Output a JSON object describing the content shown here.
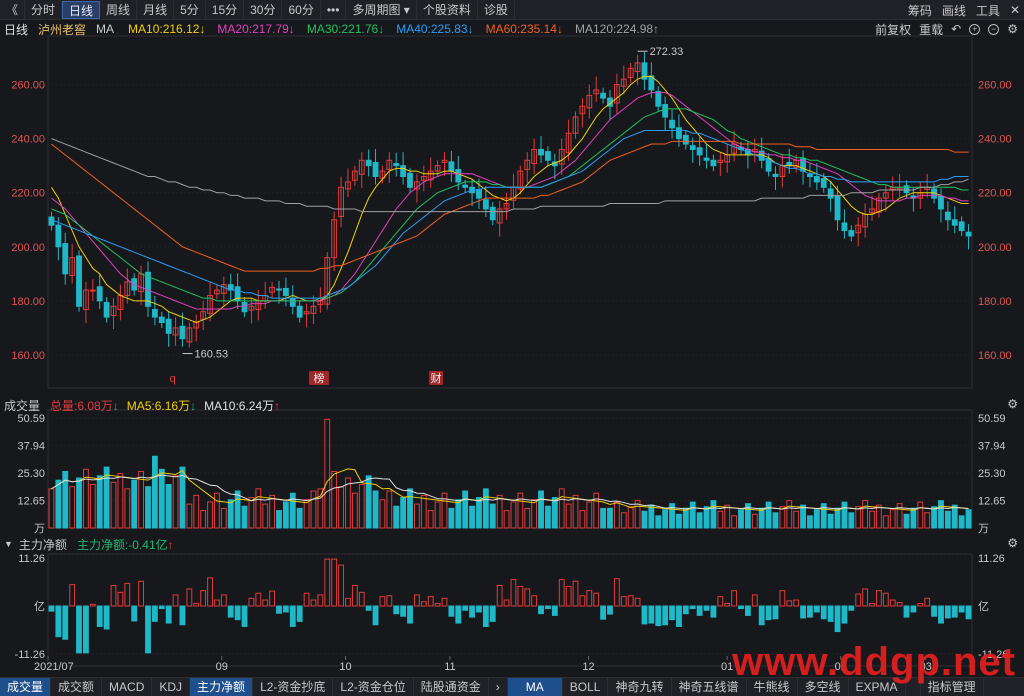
{
  "toolbar": {
    "back": "《",
    "items": [
      "分时",
      "日线",
      "周线",
      "月线",
      "5分",
      "15分",
      "30分",
      "60分",
      "•••",
      "多周期图",
      "个股资料",
      "诊股"
    ],
    "active": 1,
    "right": [
      "筹码",
      "画线",
      "工具",
      "✕"
    ]
  },
  "price_info": {
    "period": "日线",
    "name": "泸州老窖",
    "ma_label": "MA",
    "ma": [
      {
        "text": "MA10:216.12",
        "arrow": "↓",
        "color": "#f0d000"
      },
      {
        "text": "MA20:217.79",
        "arrow": "↓",
        "color": "#e040c0"
      },
      {
        "text": "MA30:221.76",
        "arrow": "↓",
        "color": "#20c060"
      },
      {
        "text": "MA40:225.83",
        "arrow": "↓",
        "color": "#2a9df4"
      },
      {
        "text": "MA60:235.14",
        "arrow": "↓",
        "color": "#f06020"
      },
      {
        "text": "MA120:224.98",
        "arrow": "↑",
        "color": "#a0a0a0"
      }
    ],
    "right": [
      "前复权",
      "重载"
    ]
  },
  "vol_info": {
    "title": "成交量",
    "total": "总量:6.08万",
    "total_arrow": "↓",
    "ma5": "MA5:6.16万",
    "ma5_arrow": "↓",
    "ma10": "MA10:6.24万",
    "ma10_arrow": "↑"
  },
  "flow_info": {
    "title": "主力净额",
    "value": "主力净额:-0.41亿",
    "arrow": "↑"
  },
  "bottom_tabs": [
    "成交量",
    "成交额",
    "MACD",
    "KDJ",
    "主力净额",
    "L2-资金抄底",
    "L2-资金仓位",
    "陆股通资金",
    "›",
    "MA",
    "BOLL",
    "神奇九转",
    "神奇五线谱",
    "牛熊线",
    "多空线",
    "EXPMA",
    "",
    "指标管理"
  ],
  "watermark": "www.ddgp.net",
  "colors": {
    "up": "#e03c3c",
    "down": "#1fb8c8",
    "bg": "#17181c",
    "axis_red": "#e05555"
  },
  "chart_data": [
    {
      "type": "candlestick",
      "title": "日线 泸州老窖",
      "ylim": [
        150,
        275
      ],
      "yticks": [
        "260.00",
        "240.00",
        "220.00",
        "200.00",
        "180.00",
        "160.00"
      ],
      "ytick_values": [
        260,
        240,
        220,
        200,
        180,
        160
      ],
      "xtick_labels": [
        "2021/07",
        "09",
        "10",
        "11",
        "12",
        "01",
        "02",
        "03"
      ],
      "annotations": [
        {
          "text": "272.33",
          "value": 272.33,
          "kind": "high"
        },
        {
          "text": "160.53",
          "value": 160.53,
          "kind": "low"
        }
      ],
      "event_markers": [
        "q",
        "榜",
        "财"
      ],
      "series_shape": {
        "close": [
          208,
          200,
          190,
          196,
          178,
          184,
          184,
          180,
          174,
          178,
          182,
          187,
          184,
          190,
          178,
          174,
          172,
          168,
          170,
          166,
          170,
          172,
          176,
          182,
          184,
          186,
          184,
          180,
          176,
          178,
          180,
          182,
          185,
          184,
          182,
          178,
          174,
          176,
          178,
          180,
          196,
          210,
          222,
          224,
          228,
          232,
          230,
          226,
          228,
          232,
          230,
          226,
          222,
          224,
          226,
          228,
          230,
          232,
          228,
          224,
          222,
          220,
          218,
          214,
          210,
          214,
          216,
          222,
          228,
          232,
          236,
          234,
          232,
          230,
          236,
          242,
          248,
          252,
          256,
          258,
          255,
          252,
          260,
          262,
          266,
          268,
          262,
          258,
          252,
          248,
          244,
          240,
          238,
          236,
          234,
          232,
          230,
          232,
          234,
          238,
          236,
          234,
          236,
          232,
          228,
          226,
          230,
          230,
          232,
          228,
          226,
          224,
          222,
          218,
          210,
          206,
          204,
          208,
          212,
          214,
          218,
          220,
          222,
          222,
          220,
          218,
          220,
          222,
          218,
          214,
          210,
          208,
          206,
          204
        ],
        "ma10": [
          222,
          218,
          212,
          206,
          200,
          196,
          192,
          190,
          186,
          184,
          182,
          181,
          180,
          180,
          180,
          179,
          178,
          176,
          175,
          174,
          173,
          172,
          173,
          174,
          176,
          178,
          180,
          181,
          181,
          181,
          180,
          180,
          180,
          180,
          181,
          182,
          181,
          180,
          180,
          180,
          182,
          186,
          192,
          198,
          205,
          212,
          218,
          222,
          225,
          228,
          229,
          229,
          228,
          228,
          227,
          227,
          227,
          228,
          228,
          227,
          226,
          225,
          223,
          221,
          219,
          218,
          217,
          218,
          220,
          223,
          226,
          228,
          230,
          231,
          232,
          234,
          237,
          240,
          244,
          248,
          251,
          253,
          255,
          257,
          260,
          262,
          263,
          263,
          261,
          258,
          255,
          251,
          247,
          244,
          241,
          238,
          236,
          235,
          234,
          234,
          234,
          234,
          234,
          234,
          233,
          231,
          230,
          230,
          230,
          229,
          228,
          227,
          226,
          224,
          221,
          218,
          215,
          213,
          212,
          212,
          213,
          214,
          216,
          218,
          219,
          220,
          220,
          220,
          220,
          219,
          218,
          217,
          216,
          216
        ],
        "ma20": [
          218,
          216,
          214,
          211,
          208,
          205,
          202,
          199,
          196,
          193,
          190,
          188,
          186,
          185,
          184,
          183,
          182,
          181,
          180,
          179,
          178,
          177,
          177,
          177,
          177,
          177,
          177,
          178,
          178,
          179,
          179,
          179,
          180,
          180,
          180,
          180,
          180,
          180,
          180,
          180,
          181,
          182,
          184,
          187,
          190,
          194,
          198,
          202,
          206,
          210,
          214,
          217,
          220,
          222,
          224,
          225,
          226,
          227,
          227,
          227,
          227,
          227,
          226,
          225,
          224,
          223,
          222,
          222,
          222,
          222,
          223,
          224,
          225,
          226,
          228,
          230,
          232,
          235,
          238,
          241,
          244,
          247,
          249,
          251,
          253,
          255,
          256,
          257,
          257,
          257,
          256,
          254,
          252,
          250,
          248,
          246,
          244,
          242,
          240,
          238,
          237,
          236,
          235,
          235,
          234,
          234,
          233,
          233,
          232,
          232,
          231,
          230,
          229,
          228,
          227,
          225,
          223,
          221,
          219,
          218,
          217,
          217,
          217,
          217,
          218,
          218,
          219,
          219,
          219,
          219,
          218,
          218,
          217,
          217
        ],
        "ma30": [
          214,
          213,
          212,
          210,
          208,
          206,
          204,
          202,
          200,
          198,
          196,
          194,
          192,
          190,
          189,
          188,
          187,
          186,
          185,
          184,
          183,
          182,
          181,
          181,
          180,
          180,
          180,
          180,
          180,
          180,
          180,
          180,
          180,
          180,
          180,
          180,
          180,
          180,
          180,
          181,
          181,
          182,
          183,
          185,
          187,
          190,
          193,
          196,
          199,
          202,
          205,
          208,
          211,
          214,
          216,
          218,
          220,
          221,
          222,
          223,
          224,
          224,
          224,
          224,
          223,
          223,
          222,
          222,
          222,
          222,
          222,
          222,
          223,
          224,
          225,
          226,
          228,
          230,
          232,
          234,
          236,
          238,
          240,
          242,
          244,
          246,
          248,
          249,
          250,
          251,
          251,
          251,
          251,
          250,
          249,
          248,
          247,
          245,
          243,
          242,
          240,
          239,
          238,
          237,
          236,
          235,
          234,
          234,
          233,
          233,
          232,
          232,
          231,
          230,
          229,
          228,
          227,
          226,
          225,
          224,
          223,
          223,
          222,
          222,
          222,
          222,
          222,
          222,
          222,
          222,
          222,
          222,
          221,
          221
        ],
        "ma40": [
          210,
          209,
          208,
          207,
          206,
          205,
          204,
          203,
          202,
          201,
          200,
          199,
          198,
          197,
          196,
          195,
          194,
          193,
          192,
          191,
          190,
          189,
          188,
          187,
          186,
          185,
          184,
          184,
          183,
          183,
          182,
          182,
          181,
          181,
          181,
          181,
          181,
          181,
          181,
          181,
          182,
          183,
          184,
          185,
          187,
          189,
          191,
          193,
          196,
          199,
          202,
          205,
          207,
          209,
          211,
          213,
          215,
          217,
          218,
          219,
          220,
          221,
          221,
          222,
          222,
          222,
          222,
          222,
          222,
          222,
          222,
          222,
          223,
          224,
          225,
          226,
          227,
          228,
          230,
          232,
          234,
          236,
          238,
          240,
          241,
          242,
          243,
          243,
          243,
          243,
          243,
          243,
          243,
          242,
          242,
          241,
          240,
          239,
          238,
          237,
          236,
          235,
          234,
          233,
          232,
          231,
          230,
          229,
          229,
          228,
          227,
          227,
          226,
          226,
          225,
          225,
          224,
          224,
          224,
          224,
          224,
          224,
          224,
          224,
          224,
          224,
          224,
          224,
          224,
          225,
          225,
          226,
          226,
          226
        ],
        "ma60": [
          238,
          236,
          234,
          232,
          230,
          228,
          226,
          224,
          222,
          220,
          218,
          216,
          214,
          212,
          210,
          208,
          206,
          204,
          202,
          200,
          199,
          198,
          197,
          196,
          195,
          194,
          193,
          192,
          191,
          191,
          191,
          191,
          191,
          191,
          191,
          191,
          191,
          191,
          191,
          192,
          192,
          193,
          193,
          194,
          195,
          196,
          197,
          198,
          199,
          200,
          201,
          202,
          203,
          204,
          206,
          208,
          210,
          212,
          213,
          214,
          215,
          216,
          217,
          218,
          218,
          218,
          218,
          218,
          218,
          218,
          218,
          219,
          219,
          220,
          221,
          222,
          223,
          224,
          226,
          228,
          230,
          232,
          233,
          234,
          235,
          236,
          237,
          238,
          238,
          238,
          239,
          239,
          239,
          239,
          239,
          239,
          239,
          239,
          239,
          239,
          238,
          238,
          238,
          238,
          238,
          238,
          238,
          238,
          237,
          237,
          237,
          236,
          236,
          236,
          236,
          236,
          236,
          236,
          236,
          236,
          236,
          236,
          236,
          236,
          236,
          236,
          236,
          236,
          236,
          236,
          236,
          235,
          235,
          235
        ],
        "ma120": [
          240,
          239,
          238,
          237,
          236,
          235,
          234,
          233,
          232,
          231,
          230,
          229,
          228,
          227,
          226,
          226,
          225,
          224,
          224,
          223,
          222,
          222,
          221,
          221,
          220,
          220,
          219,
          219,
          218,
          218,
          218,
          217,
          217,
          217,
          216,
          216,
          216,
          215,
          215,
          215,
          215,
          214,
          214,
          214,
          214,
          213,
          213,
          213,
          213,
          213,
          213,
          213,
          213,
          213,
          213,
          213,
          213,
          213,
          213,
          213,
          213,
          213,
          213,
          213,
          213,
          213,
          213,
          214,
          214,
          214,
          214,
          215,
          215,
          215,
          215,
          215,
          215,
          215,
          215,
          215,
          215,
          216,
          216,
          216,
          216,
          216,
          216,
          216,
          216,
          217,
          217,
          217,
          217,
          217,
          217,
          217,
          217,
          217,
          217,
          217,
          217,
          217,
          217,
          218,
          218,
          218,
          218,
          218,
          218,
          218,
          219,
          219,
          219,
          219,
          219,
          219,
          220,
          220,
          220,
          220,
          221,
          221,
          221,
          221,
          221,
          221,
          222,
          222,
          222,
          223,
          223,
          224,
          224,
          225
        ]
      }
    },
    {
      "type": "bar",
      "title": "成交量",
      "ylim": [
        0,
        50.59
      ],
      "yticks": [
        "50.59",
        "37.94",
        "25.30",
        "12.65",
        "万"
      ],
      "ytick_values": [
        50.59,
        37.94,
        25.3,
        12.65,
        0
      ]
    },
    {
      "type": "bar",
      "title": "主力净额",
      "ylim": [
        -11.26,
        11.26
      ],
      "yticks": [
        "11.26",
        "亿",
        "-11.26"
      ],
      "ytick_values": [
        11.26,
        0,
        -11.26
      ]
    }
  ]
}
